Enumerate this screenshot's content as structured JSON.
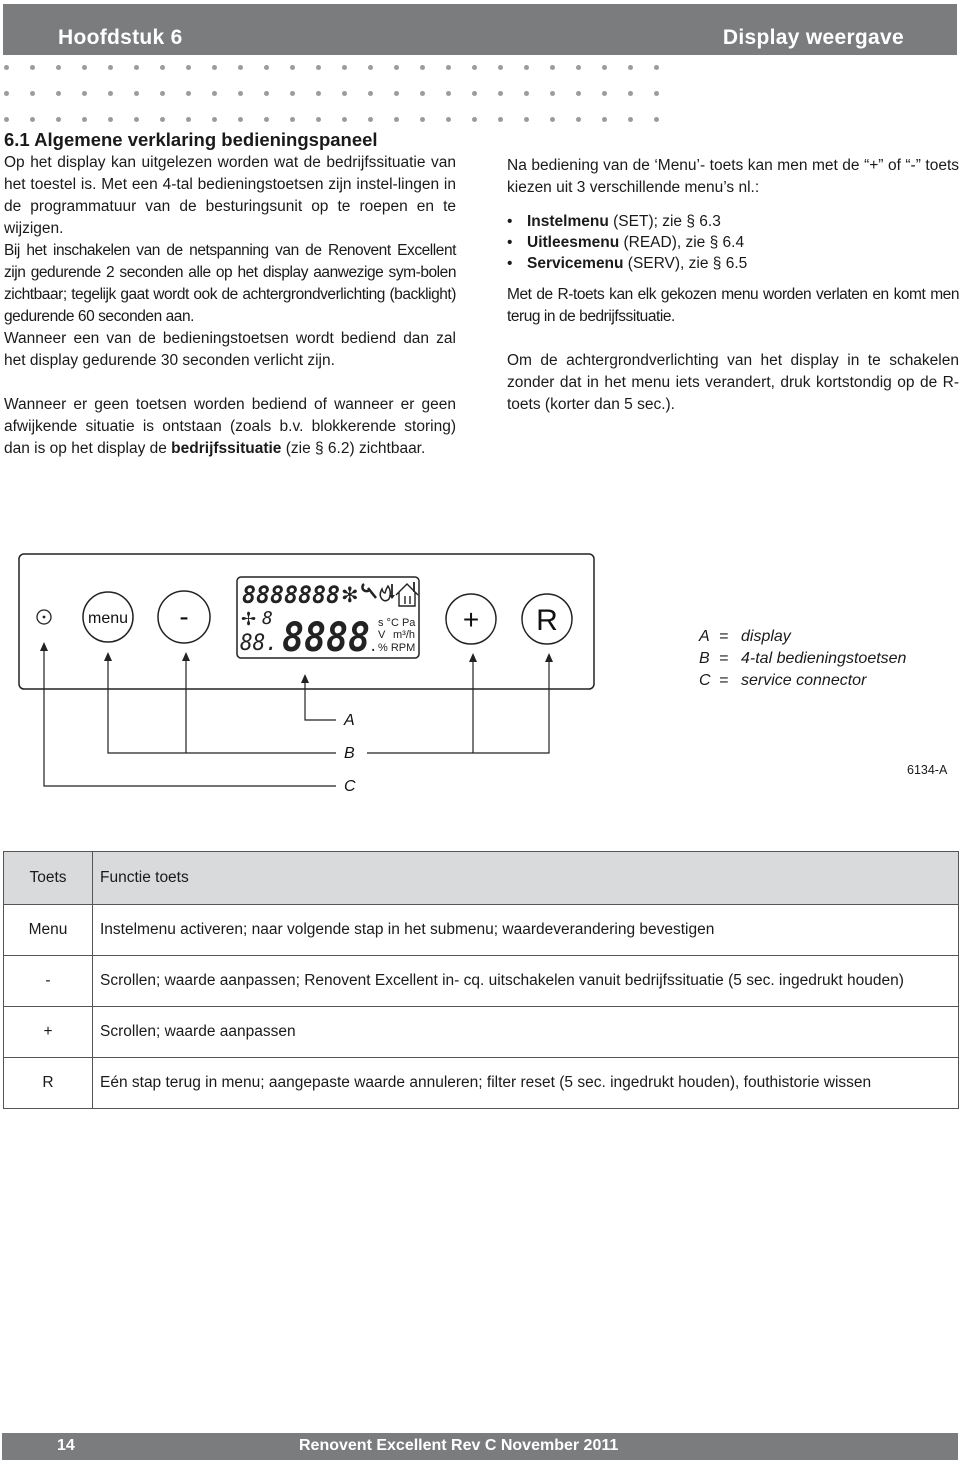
{
  "header": {
    "chapter": "Hoofdstuk 6",
    "topic": "Display weergave"
  },
  "colors": {
    "band": "#7b7c7e",
    "dots": "#9a9b9d",
    "table_header": "#d9dadb"
  },
  "left_column": {
    "section_title": "6.1 Algemene verklaring bedieningspaneel",
    "paragraphs": [
      "Op het display kan uitgelezen worden wat de bedrijfssituatie van het toestel is. Met een 4-tal bedieningstoetsen zijn instel-lingen in de programmatuur van de besturingsunit op te roepen en te wijzigen.",
      "Bij het inschakelen van de netspanning van de Renovent Excellent zijn gedurende 2 seconden alle op het display aanwezige sym-bolen zichtbaar; tegelijk gaat wordt ook de achtergrondverlichting (backlight) gedurende 60 seconden aan.",
      "Wanneer een van de bedieningstoetsen wordt bediend dan zal het display gedurende 30 seconden verlicht zijn."
    ],
    "last_paragraph": {
      "before": "Wanneer er geen toetsen worden bediend of wanneer er geen afwijkende situatie is ontstaan (zoals b.v. blokkerende storing) dan is op het display de ",
      "bold": "bedrijfssituatie",
      "after": " (zie § 6.2) zichtbaar."
    }
  },
  "right_column": {
    "intro": "Na bediening van de ‘Menu’- toets kan men met de “+” of “-” toets kiezen uit 3 verschillende menu’s nl.:",
    "menus": [
      {
        "bullet": "•",
        "name": "Instelmenu",
        "detail": " (SET); zie § 6.3"
      },
      {
        "bullet": "•",
        "name": "Uitleesmenu",
        "detail": " (READ), zie § 6.4"
      },
      {
        "bullet": "•",
        "name": "Servicemenu",
        "detail": " (SERV), zie § 6.5"
      }
    ],
    "r_key_text": "Met de R-toets kan elk gekozen menu worden verlaten en komt men terug in de bedrijfssituatie.",
    "backlight_text": "Om de achtergrondverlichting van het display in te schakelen zonder dat in het menu iets verandert, druk kortstondig op de R-toets (korter dan 5 sec.)."
  },
  "diagram": {
    "buttons": {
      "menu": "menu",
      "minus": "-",
      "plus": "+",
      "reset": "R"
    },
    "lcd": {
      "alnum_segments": "8888888",
      "small_digit": "8",
      "left_digits": "88.",
      "main_digits": "8888",
      "units_row1": "s °C Pa",
      "units_row2_v": "V",
      "units_row2_flow": "m³/h",
      "units_row3": "% RPM"
    },
    "callouts": {
      "a": "A",
      "b": "B",
      "c": "C"
    }
  },
  "legend": [
    {
      "key": "A",
      "eq": "=",
      "text": "display"
    },
    {
      "key": "B",
      "eq": "=",
      "text": "4-tal bedieningstoetsen"
    },
    {
      "key": "C",
      "eq": "=",
      "text": "service connector"
    }
  ],
  "figure_code": "6134-A",
  "table": {
    "headers": [
      "Toets",
      "Functie toets"
    ],
    "rows": [
      [
        "Menu",
        "Instelmenu activeren; naar volgende stap in het submenu; waardeverandering bevestigen"
      ],
      [
        "-",
        "Scrollen; waarde aanpassen; Renovent Excellent in- cq. uitschakelen vanuit bedrijfssituatie (5 sec. ingedrukt houden)"
      ],
      [
        "+",
        "Scrollen; waarde aanpassen"
      ],
      [
        "R",
        "Eén stap terug in menu; aangepaste waarde annuleren; filter reset (5 sec. ingedrukt houden), fouthistorie wissen"
      ]
    ]
  },
  "footer": {
    "page_number": "14",
    "document_title": "Renovent Excellent Rev C  November 2011"
  }
}
